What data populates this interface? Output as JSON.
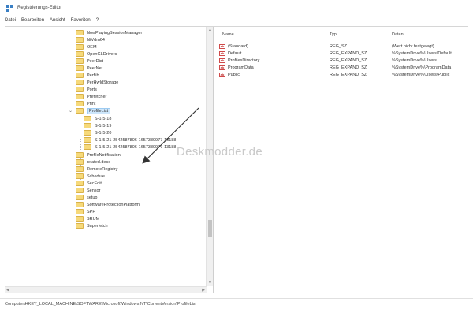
{
  "window": {
    "title": "Registrierungs-Editor"
  },
  "menu": [
    "Datei",
    "Bearbeiten",
    "Ansicht",
    "Favoriten",
    "?"
  ],
  "tree": {
    "items": [
      {
        "label": "NowPlayingSessionManager"
      },
      {
        "label": "NtVdm64"
      },
      {
        "label": "OEM"
      },
      {
        "label": "OpenGLDrivers"
      },
      {
        "label": "PeerDist"
      },
      {
        "label": "PeerNet"
      },
      {
        "label": "Perflib"
      },
      {
        "label": "PerHwIdStorage"
      },
      {
        "label": "Ports"
      },
      {
        "label": "Prefetcher"
      },
      {
        "label": "Print"
      },
      {
        "label": "ProfileList"
      },
      {
        "label": "S-1-5-18"
      },
      {
        "label": "S-1-5-19"
      },
      {
        "label": "S-1-5-20"
      },
      {
        "label": "S-1-5-21-2542587806-1657339977-13188"
      },
      {
        "label": "S-1-5-21-2542587806-1657339977-13188"
      },
      {
        "label": "ProfileNotification"
      },
      {
        "label": "related.desc"
      },
      {
        "label": "RemoteRegistry"
      },
      {
        "label": "Schedule"
      },
      {
        "label": "SecEdit"
      },
      {
        "label": "Sensor"
      },
      {
        "label": "setup"
      },
      {
        "label": "SoftwareProtectionPlatform"
      },
      {
        "label": "SPP"
      },
      {
        "label": "SRUM"
      },
      {
        "label": "Superfetch"
      }
    ]
  },
  "list": {
    "headers": {
      "name": "Name",
      "type": "Typ",
      "data": "Daten"
    },
    "rows": [
      {
        "name": "(Standard)",
        "type": "REG_SZ",
        "data": "(Wert nicht festgelegt)"
      },
      {
        "name": "Default",
        "type": "REG_EXPAND_SZ",
        "data": "%SystemDrive%\\Users\\Default"
      },
      {
        "name": "ProfilesDirectory",
        "type": "REG_EXPAND_SZ",
        "data": "%SystemDrive%\\Users"
      },
      {
        "name": "ProgramData",
        "type": "REG_EXPAND_SZ",
        "data": "%SystemDrive%\\ProgramData"
      },
      {
        "name": "Public",
        "type": "REG_EXPAND_SZ",
        "data": "%SystemDrive%\\Users\\Public"
      }
    ],
    "value_icon": "ab-icon"
  },
  "watermark": "Deskmodder.de",
  "status": {
    "path": "Computer\\HKEY_LOCAL_MACHINE\\SOFTWARE\\Microsoft\\Windows NT\\CurrentVersion\\ProfileList"
  },
  "colors": {
    "selection": "#cde6fb",
    "folder": "#f6d97a",
    "value_icon": "#d04a4a"
  }
}
